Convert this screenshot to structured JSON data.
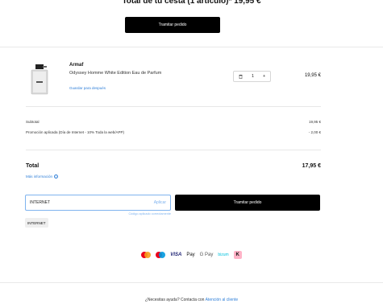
{
  "header": {
    "title": "Total de tu cesta (1 artículo)* 19,95 €",
    "checkout_label": "Tramitar pedido"
  },
  "product": {
    "brand": "Armaf",
    "name": "Odyssey Homme White Edition Eau de Parfum",
    "save_later": "Guardar para después",
    "quantity": "1",
    "minus": "−",
    "plus": "+",
    "price": "19,95 €",
    "image_icon": "perfume-bottle-icon",
    "delete_icon": "trash-icon"
  },
  "summary": {
    "subtotal_label": "Subtotal",
    "subtotal_value": "19,95 €",
    "promo_label": "Promoción aplicada (Día de Internet - 10% Toda la web/APP)",
    "promo_value": "- 2,00 €",
    "total_label": "Total",
    "total_value": "17,95 €",
    "more_info": "Más información",
    "info_icon": "i"
  },
  "promo": {
    "code_value": "INTERNET",
    "apply_label": "Aplicar",
    "applied_message": "Código aplicado correctamente",
    "chip_label": "INTERNET",
    "checkout_label": "Tramitar pedido"
  },
  "payments": {
    "visa": "VISA",
    "applepay": "Pay",
    "apple_glyph": "",
    "gpay": "G Pay",
    "bizum": "bizum",
    "klarna": "K",
    "icons": [
      "mastercard-icon",
      "maestro-icon",
      "visa-icon",
      "apple-pay-icon",
      "google-pay-icon",
      "bizum-icon",
      "klarna-icon"
    ],
    "colors": {
      "mastercard_red": "#eb001b",
      "mastercard_yellow": "#f79e1b",
      "maestro_blue": "#0099df",
      "visa_blue": "#1a1f71",
      "bizum_teal": "#05c3de",
      "klarna_pink": "#ffb3c7"
    }
  },
  "footer": {
    "help_text": "¿Necesitas ayuda? Contacta con",
    "help_link": "Atención al cliente"
  },
  "colors": {
    "accent": "#2f7fd8",
    "button_bg": "#000000",
    "promo_border": "#7fb3ee"
  }
}
